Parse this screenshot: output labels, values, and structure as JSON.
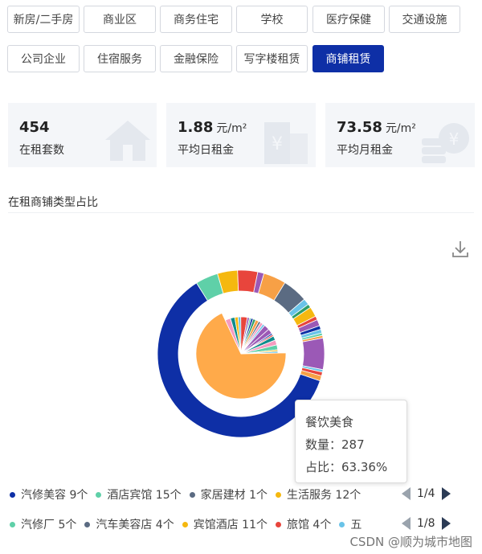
{
  "filters": [
    {
      "label": "新房/二手房",
      "active": false
    },
    {
      "label": "商业区",
      "active": false
    },
    {
      "label": "商务住宅",
      "active": false
    },
    {
      "label": "学校",
      "active": false
    },
    {
      "label": "医疗保健",
      "active": false
    },
    {
      "label": "交通设施",
      "active": false
    },
    {
      "label": "公司企业",
      "active": false
    },
    {
      "label": "住宿服务",
      "active": false
    },
    {
      "label": "金融保险",
      "active": false
    },
    {
      "label": "写字楼租赁",
      "active": false
    },
    {
      "label": "商铺租赁",
      "active": true
    }
  ],
  "stats": {
    "count": {
      "value": "454",
      "unit": "",
      "label": "在租套数",
      "icon": "house-icon"
    },
    "daily": {
      "value": "1.88",
      "unit": "元/m²",
      "label": "平均日租金",
      "icon": "building-yen-icon"
    },
    "monthly": {
      "value": "73.58",
      "unit": "元/m²",
      "label": "平均月租金",
      "icon": "coins-yen-icon"
    }
  },
  "section": {
    "title": "在租商铺类型占比"
  },
  "colors": {
    "primary": "#0e2fa6",
    "inner": "#ffaa4a",
    "bg_card": "#f4f6f9"
  },
  "chart_data": {
    "type": "pie",
    "series": [
      {
        "name": "outer",
        "labels": [],
        "values": [
          250,
          18,
          16,
          16,
          5,
          18,
          20,
          5,
          3,
          8,
          3,
          5,
          3,
          3,
          2,
          2,
          25,
          2,
          3,
          4
        ]
      },
      {
        "name": "inner",
        "labels": [
          "餐饮美食"
        ],
        "values": [
          287,
          10,
          8,
          6,
          5,
          12,
          4,
          3,
          4,
          5,
          6,
          4,
          5,
          4,
          10,
          9,
          3,
          3,
          8,
          9,
          9,
          3,
          3
        ]
      }
    ]
  },
  "tooltip": {
    "name": "餐饮美食",
    "count": "数量：287",
    "ratio": "占比：63.36%"
  },
  "legend1": {
    "items": [
      {
        "label": "汽修美容 9个",
        "color": "#0e2fa6"
      },
      {
        "label": "酒店宾馆 15个",
        "color": "#5fd0a8"
      },
      {
        "label": "家居建材 1个",
        "color": "#5b6b82"
      },
      {
        "label": "生活服务 12个",
        "color": "#f5b80f"
      }
    ],
    "page": "1/4"
  },
  "legend2": {
    "items": [
      {
        "label": "汽修厂 5个",
        "color": "#5fd0a8"
      },
      {
        "label": "汽车美容店 4个",
        "color": "#5b6b82"
      },
      {
        "label": "宾馆酒店 11个",
        "color": "#f5b80f"
      },
      {
        "label": "旅馆 4个",
        "color": "#e8453c"
      },
      {
        "label": "五",
        "color": "#69c3e8"
      }
    ],
    "page": "1/8"
  },
  "watermark": "CSDN @顺为城市地图"
}
